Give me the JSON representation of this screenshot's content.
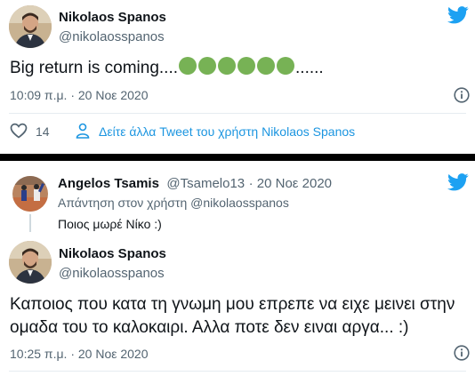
{
  "tweet1": {
    "author_name": "Nikolaos Spanos",
    "author_handle": "@nikolaosspanos",
    "text_before": "Big return is coming....",
    "emoji": "green-circle",
    "emoji_count": 6,
    "text_after": "......",
    "timestamp": "10:09 π.μ. · 20 Νοε 2020",
    "likes": "14",
    "more_tweets_link": "Δείτε άλλα Tweet του χρήστη Nikolaos Spanos"
  },
  "tweet2": {
    "reply": {
      "author_name": "Angelos Tsamis",
      "author_handle": "@Tsamelo13",
      "date": "· 20 Νοε 2020",
      "replying_to_prefix": "Απάντηση στον χρήστη",
      "replying_to_handle": "@nikolaosspanos",
      "text": "Ποιος μωρέ Νίκο :)"
    },
    "author_name": "Nikolaos Spanos",
    "author_handle": "@nikolaosspanos",
    "text": "Καποιος που κατα τη γνωμη μου επρεπε να ειχε μεινει στην ομαδα του το καλοκαιρι. Αλλα ποτε δεν ειναι αργα... :)",
    "timestamp": "10:25 π.μ. · 20 Νοε 2020"
  },
  "colors": {
    "twitter_blue": "#1da1f2",
    "link_blue": "#1b95e0",
    "secondary_text": "#536471",
    "emoji_green": "#77b255"
  },
  "icons": [
    "twitter-bird-icon",
    "info-icon",
    "heart-icon",
    "user-icon"
  ]
}
